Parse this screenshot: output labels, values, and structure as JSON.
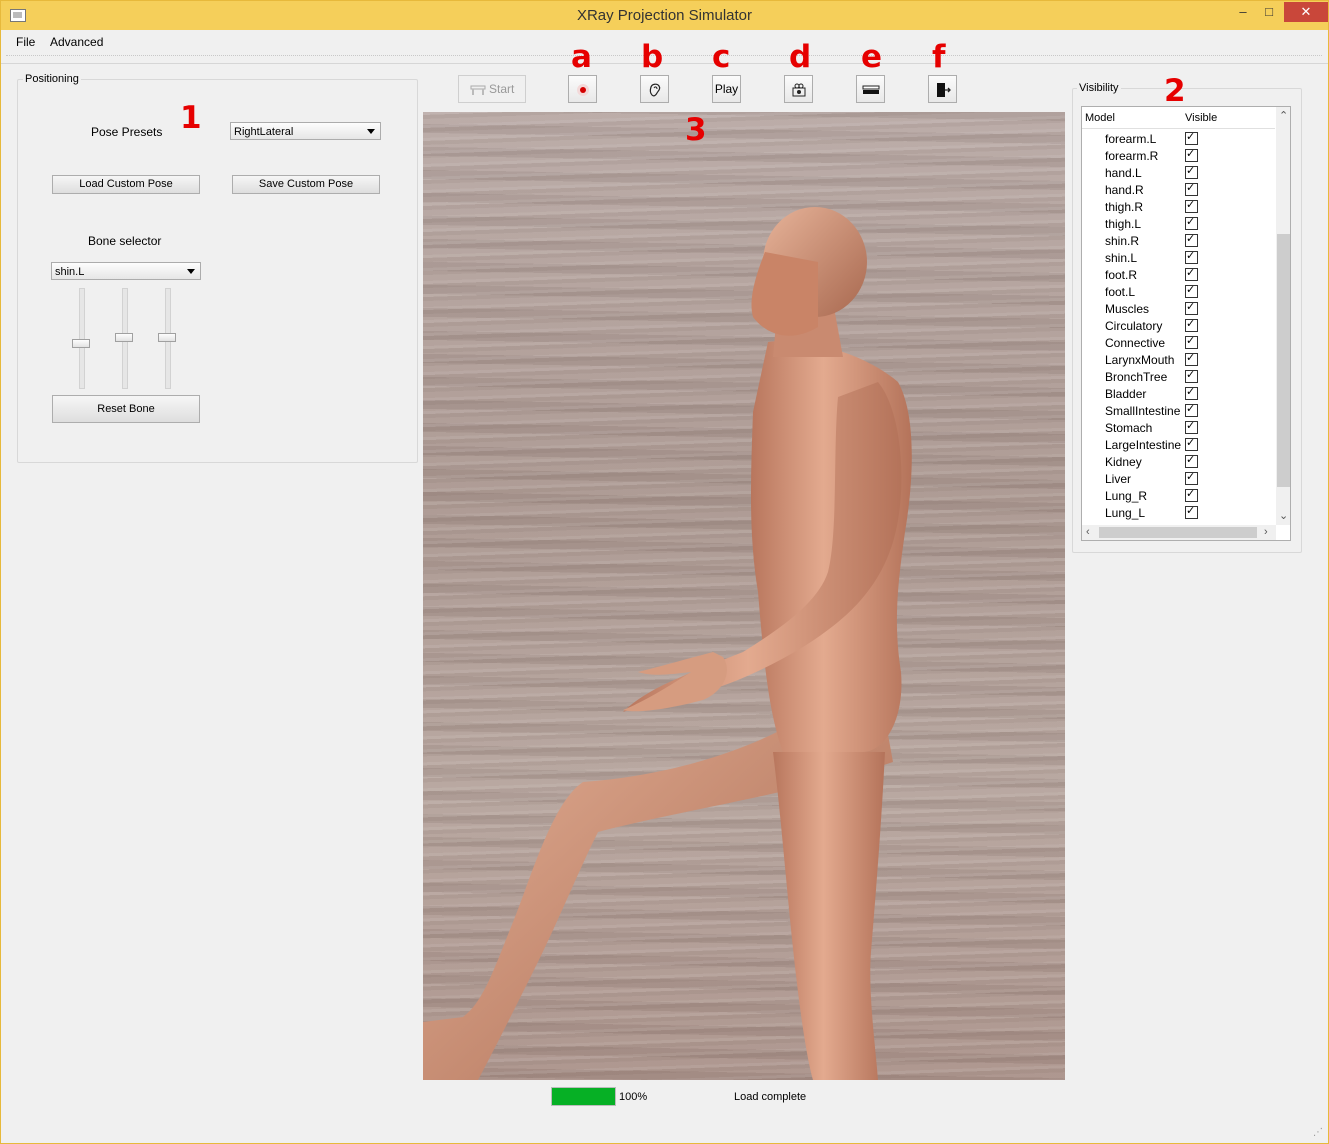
{
  "window": {
    "title": "XRay Projection Simulator",
    "min": "–",
    "max": "□",
    "close": "✕"
  },
  "menu": {
    "file": "File",
    "advanced": "Advanced"
  },
  "positioning": {
    "title": "Positioning",
    "pose_presets_label": "Pose Presets",
    "pose_preset_value": "RightLateral",
    "load_custom_pose": "Load Custom Pose",
    "save_custom_pose": "Save Custom Pose",
    "bone_selector_label": "Bone selector",
    "bone_value": "shin.L",
    "reset_bone": "Reset Bone",
    "sliders": [
      0.45,
      0.5,
      0.5
    ]
  },
  "annotations": {
    "n1": "1",
    "n2": "2",
    "n3": "3",
    "a": "a",
    "b": "b",
    "c": "c",
    "d": "d",
    "e": "e",
    "f": "f"
  },
  "toolbar": {
    "start": "Start",
    "play": "Play"
  },
  "visibility": {
    "title": "Visibility",
    "col_model": "Model",
    "col_visible": "Visible",
    "rows": [
      "forearm.L",
      "forearm.R",
      "hand.L",
      "hand.R",
      "thigh.R",
      "thigh.L",
      "shin.R",
      "shin.L",
      "foot.R",
      "foot.L",
      "Muscles",
      "Circulatory",
      "Connective",
      "LarynxMouth",
      "BronchTree",
      "Bladder",
      "SmallIntestine",
      "Stomach",
      "LargeIntestine",
      "Kidney",
      "Liver",
      "Lung_R",
      "Lung_L"
    ]
  },
  "status": {
    "progress_percent": 100,
    "progress_label": "100%",
    "message": "Load complete"
  },
  "colors": {
    "titlebar": "#f5cf5a",
    "marker": "#e60000",
    "progress": "#06b025",
    "skin": "#d49a80"
  }
}
